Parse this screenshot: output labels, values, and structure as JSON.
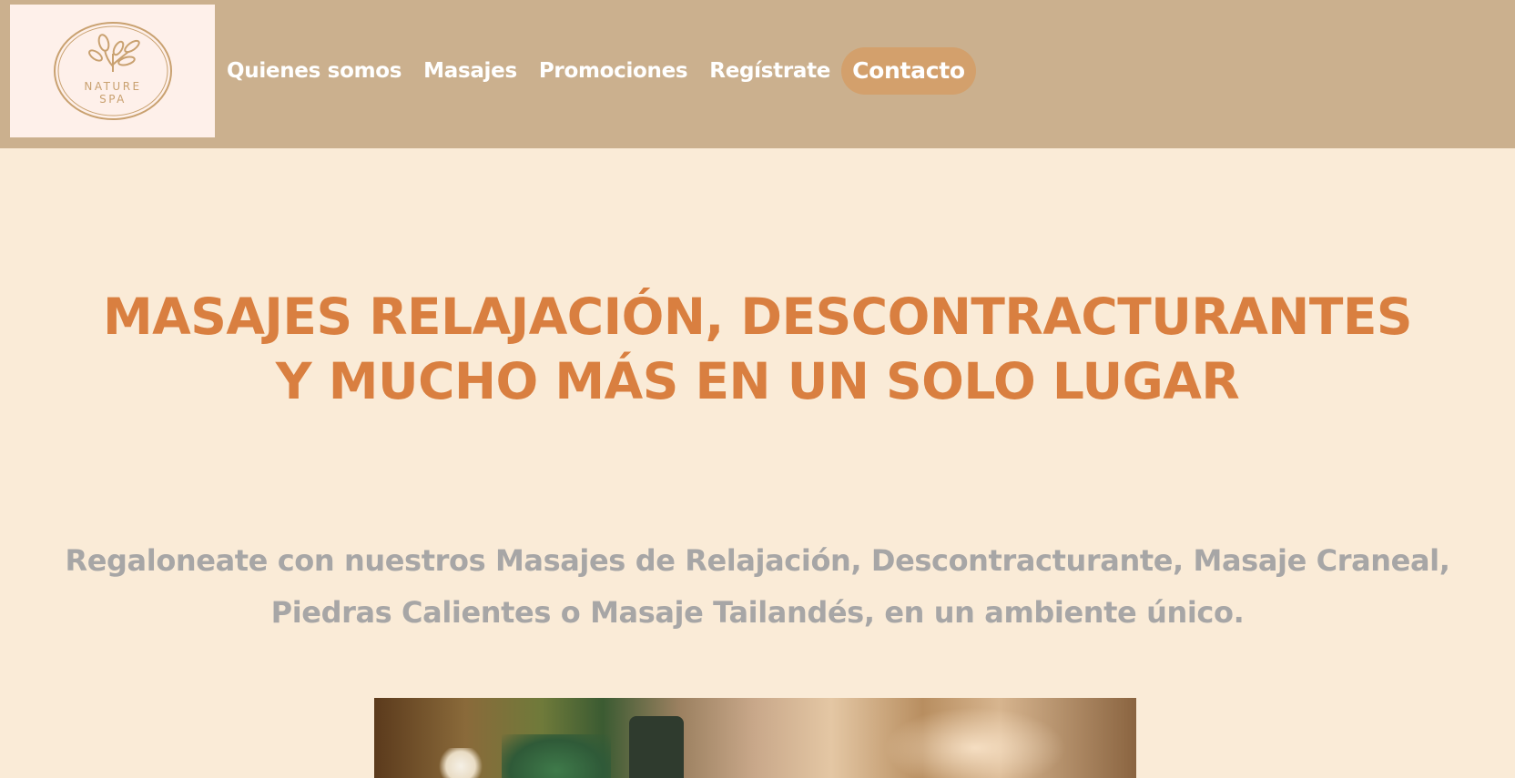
{
  "logo": {
    "line1": "NATURE",
    "line2": "SPA",
    "icon": "leaves-icon"
  },
  "nav": {
    "items": [
      {
        "label": "Quienes somos"
      },
      {
        "label": "Masajes"
      },
      {
        "label": "Promociones"
      },
      {
        "label": "Regístrate"
      },
      {
        "label": "Contacto"
      }
    ]
  },
  "hero": {
    "headline_line1": "MASAJES RELAJACIÓN, DESCONTRACTURANTES",
    "headline_line2": "Y MUCHO MÁS EN UN SOLO LUGAR",
    "subtitle_line1": "Regaloneate con nuestros Masajes de Relajación, Descontracturante, Masaje Craneal,",
    "subtitle_line2": "Piedras Calientes o Masaje Tailandés, en un ambiente único."
  },
  "colors": {
    "navbar_bg": "#cbb08e",
    "page_bg": "#faebd7",
    "logo_bg": "#fef0ea",
    "headline": "#d97f40",
    "subtitle": "#a7a6a6",
    "active_nav_bg": "#d3a06c",
    "logo_stroke": "#c9a170"
  }
}
